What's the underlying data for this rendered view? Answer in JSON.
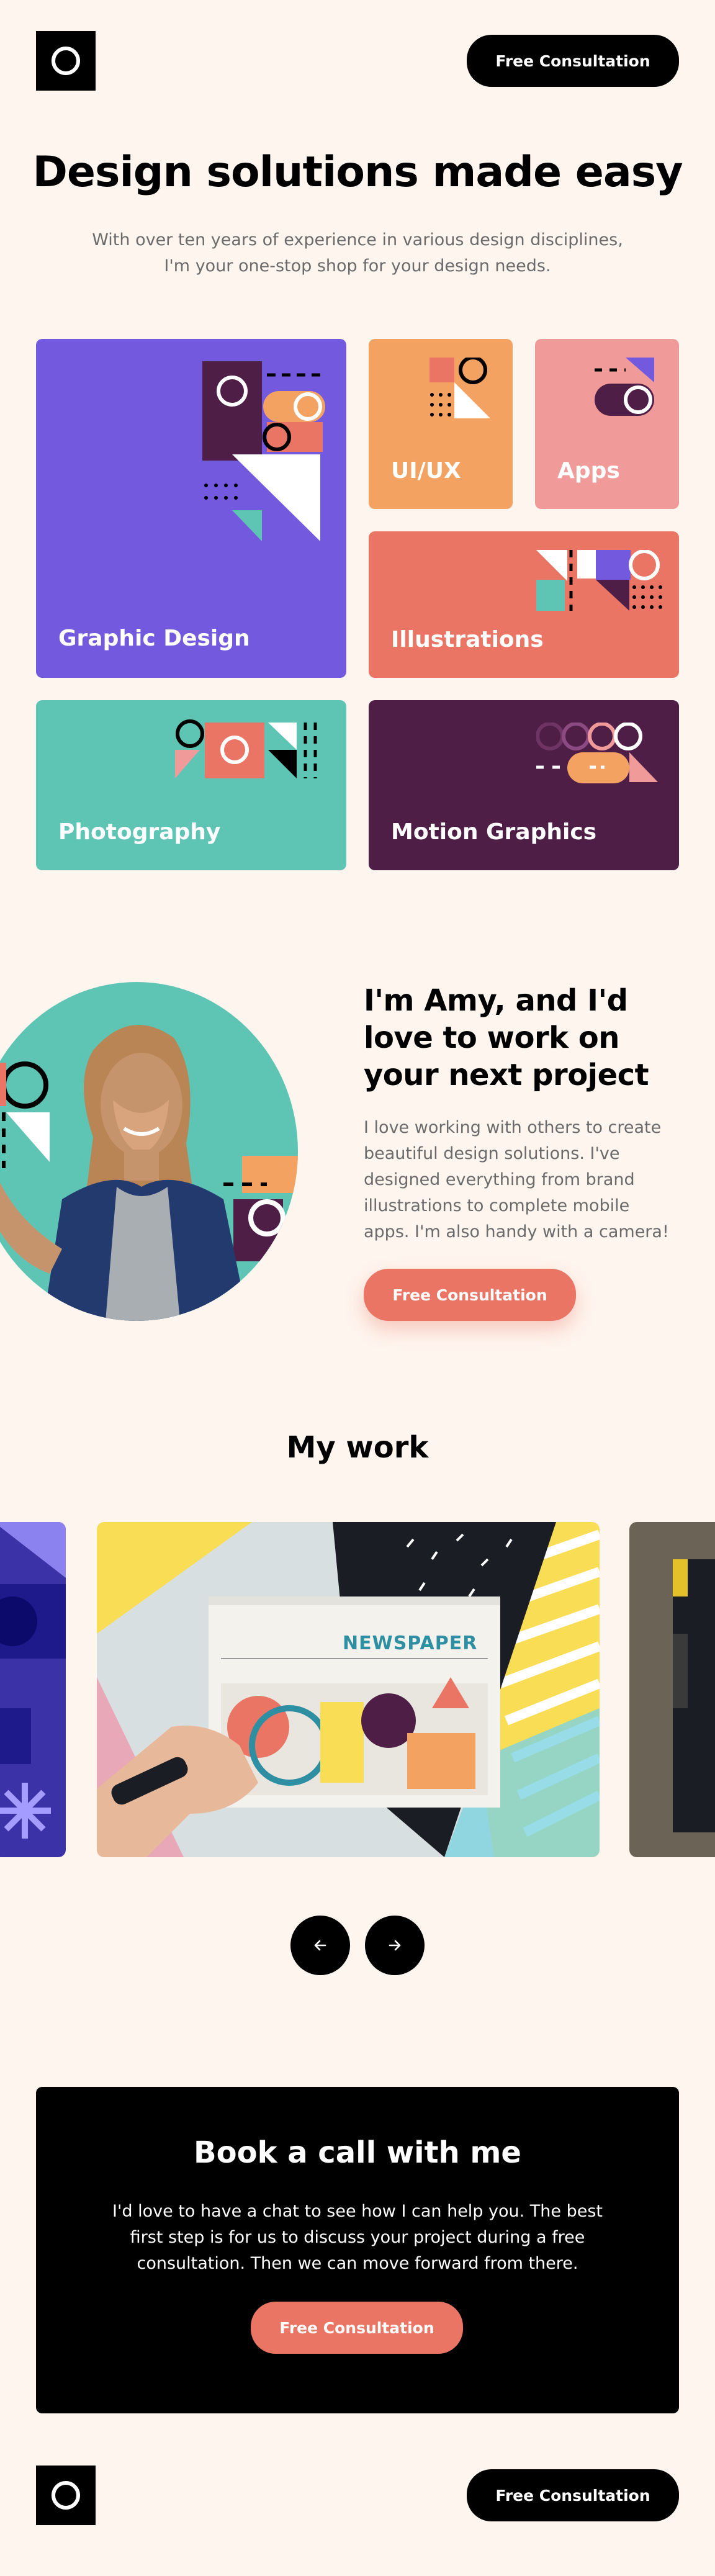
{
  "header": {
    "logo_icon": "ring-logo-icon",
    "cta_label": "Free Consultation"
  },
  "hero": {
    "title": "Design solutions made easy",
    "subtitle": "With over ten years of experience in various design disciplines, I'm your one-stop shop for your design needs."
  },
  "services": {
    "graphic_design": "Graphic Design",
    "ui_ux": "UI/UX",
    "apps": "Apps",
    "illustrations": "Illustrations",
    "photography": "Photography",
    "motion_graphics": "Motion Graphics"
  },
  "about": {
    "title": "I'm Amy, and I'd love to work on your next project",
    "text": "I love working with others to create beautiful design solutions. I've designed everything from brand illustrations to complete mobile apps. I'm also handy with a camera!",
    "cta_label": "Free Consultation"
  },
  "work": {
    "title": "My work",
    "newspaper_word": "NEWSPAPER",
    "prev_icon": "arrow-left-icon",
    "next_icon": "arrow-right-icon"
  },
  "cta": {
    "title": "Book a call with me",
    "text": "I'd love to have a chat to see how I can help you. The best first step is for us to discuss your project during a free consultation. Then we can move forward from there.",
    "button_label": "Free Consultation"
  },
  "footer": {
    "logo_icon": "ring-logo-icon",
    "cta_label": "Free Consultation"
  },
  "colors": {
    "background": "#FEF5EE",
    "purple": "#7359DE",
    "orange": "#F4A261",
    "pink": "#F09B9A",
    "coral": "#EA7564",
    "teal": "#5EC5B5",
    "plum": "#4E1E47"
  }
}
